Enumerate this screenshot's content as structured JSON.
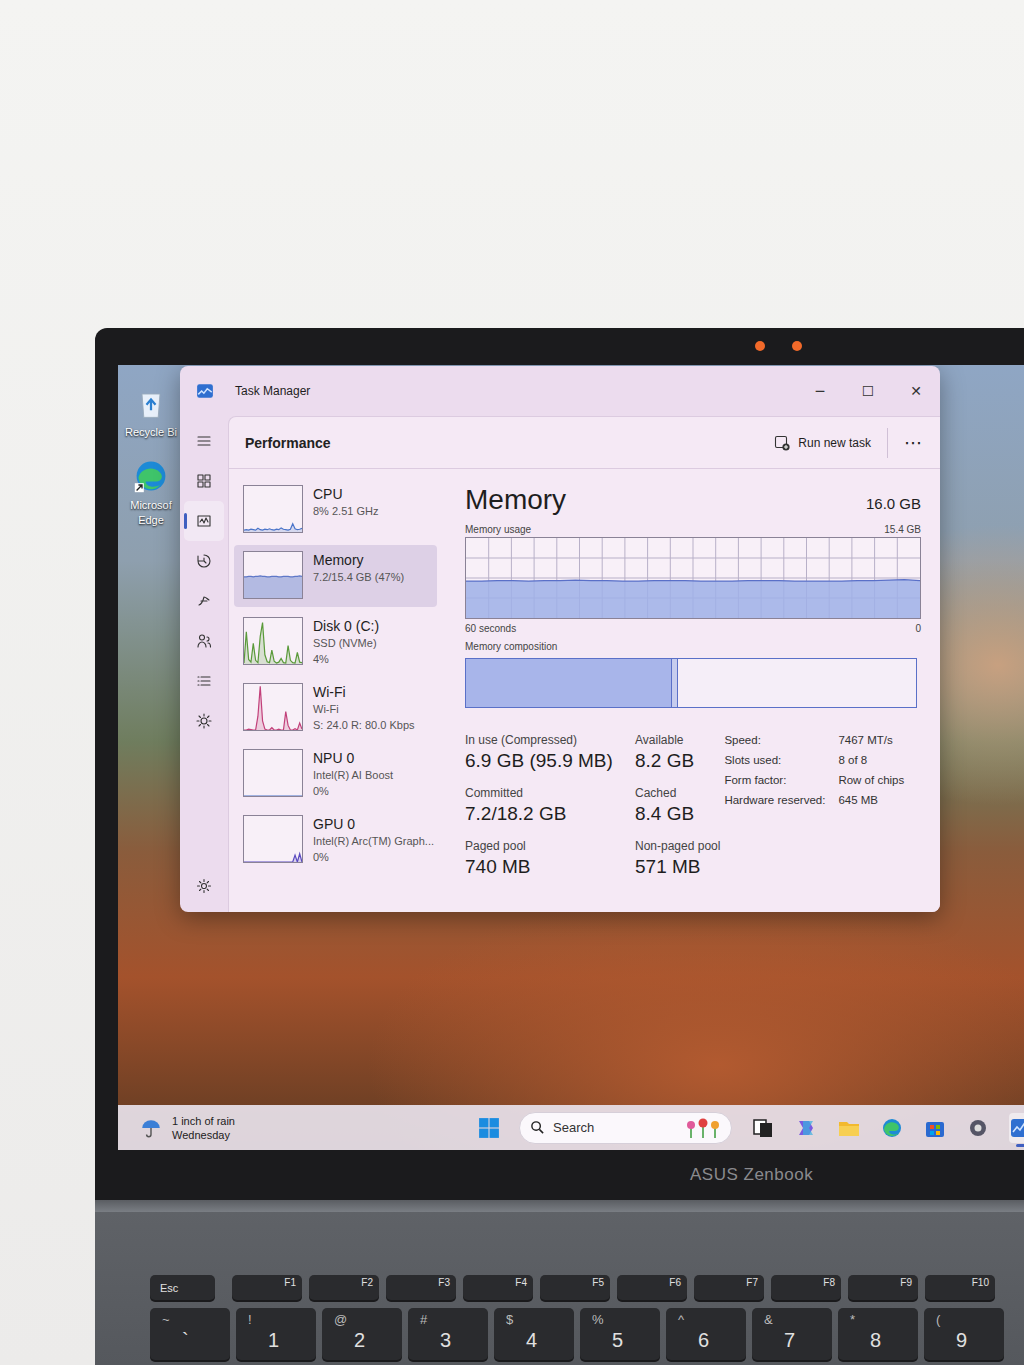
{
  "desktop": {
    "icons": [
      {
        "lines": [
          "Recycle Bi"
        ]
      },
      {
        "lines": [
          "Microsof",
          "Edge"
        ]
      }
    ]
  },
  "window": {
    "title": "Task Manager",
    "controls": [
      "─",
      "☐",
      "✕"
    ]
  },
  "nav": [
    {
      "selected": false
    },
    {
      "selected": false
    },
    {
      "selected": true
    },
    {
      "selected": false
    },
    {
      "selected": false
    },
    {
      "selected": false
    },
    {
      "selected": false
    },
    {
      "selected": false
    },
    {
      "selected": false
    }
  ],
  "header": {
    "title": "Performance",
    "runTask": "Run new task",
    "more": "⋯"
  },
  "resources": [
    {
      "name": "CPU",
      "lines": [
        "8% 2.51 GHz"
      ],
      "selected": false,
      "color": "#4a74c9",
      "values": [
        4,
        5,
        4,
        6,
        5,
        4,
        8,
        5,
        4,
        6,
        5,
        7,
        5,
        4,
        6,
        5,
        9,
        6,
        5,
        4,
        6,
        18,
        7,
        5,
        6,
        8
      ]
    },
    {
      "name": "Memory",
      "lines": [
        "7.2/15.4 GB (47%)"
      ],
      "selected": true,
      "color": "#5f78c8",
      "values": [
        46,
        46,
        47,
        47,
        46,
        47,
        47,
        48,
        47,
        47,
        46,
        46,
        47,
        47,
        47,
        46,
        46,
        47,
        47,
        47,
        46,
        46,
        47,
        47,
        48,
        47
      ]
    },
    {
      "name": "Disk 0 (C:)",
      "lines": [
        "SSD (NVMe)",
        "4%"
      ],
      "selected": false,
      "color": "#5a9a3a",
      "values": [
        2,
        70,
        10,
        4,
        45,
        8,
        3,
        60,
        90,
        20,
        5,
        3,
        30,
        6,
        2,
        4,
        12,
        3,
        2,
        40,
        8,
        3,
        2,
        25,
        4,
        3
      ]
    },
    {
      "name": "Wi-Fi",
      "lines": [
        "Wi-Fi",
        "S: 24.0 R: 80.0 Kbps"
      ],
      "selected": false,
      "color": "#c2407a",
      "values": [
        0,
        0,
        2,
        1,
        0,
        0,
        30,
        95,
        20,
        2,
        0,
        0,
        5,
        0,
        0,
        2,
        0,
        0,
        40,
        10,
        0,
        0,
        3,
        0,
        15,
        2
      ]
    },
    {
      "name": "NPU 0",
      "lines": [
        "Intel(R) AI Boost",
        "0%"
      ],
      "selected": false,
      "color": "#4a74c9",
      "values": [
        0,
        0,
        0,
        0,
        0,
        0,
        0,
        0,
        0,
        0,
        0,
        0,
        0,
        0,
        0,
        0,
        0,
        0,
        0,
        0,
        0,
        0,
        0,
        0,
        0,
        0
      ]
    },
    {
      "name": "GPU 0",
      "lines": [
        "Intel(R) Arc(TM) Graph...",
        "0%"
      ],
      "selected": false,
      "color": "#5a4ac0",
      "values": [
        0,
        0,
        0,
        0,
        0,
        0,
        0,
        0,
        0,
        0,
        0,
        0,
        0,
        0,
        0,
        0,
        0,
        0,
        0,
        0,
        0,
        0,
        15,
        0,
        18,
        0
      ]
    }
  ],
  "memory": {
    "title": "Memory",
    "total": "16.0 GB",
    "usageLabel": "Memory usage",
    "max": "15.4 GB",
    "maxValue": 15.4,
    "usage": [
      7.1,
      7.1,
      7.2,
      7.2,
      7.1,
      7.2,
      7.2,
      7.3,
      7.2,
      7.2,
      7.1,
      7.1,
      7.2,
      7.2,
      7.2,
      7.1,
      7.1,
      7.1,
      7.2,
      7.2,
      7.2,
      7.1,
      7.1,
      7.1,
      7.1,
      7.2,
      7.2,
      7.3,
      7.4,
      7.2
    ],
    "timeLeft": "60 seconds",
    "timeRight": "0",
    "compositionLabel": "Memory composition",
    "composition": [
      {
        "kind": "inuse",
        "level": 0.455
      },
      {
        "kind": "modified",
        "level": 0.012
      }
    ],
    "stats": [
      {
        "label": "In use (Compressed)",
        "value": "6.9 GB (95.9 MB)"
      },
      {
        "label": "Available",
        "value": "8.2 GB"
      },
      {
        "label": "Committed",
        "value": "7.2/18.2 GB"
      },
      {
        "label": "Cached",
        "value": "8.4 GB"
      },
      {
        "label": "Paged pool",
        "value": "740 MB"
      },
      {
        "label": "Non-paged pool",
        "value": "571 MB"
      }
    ],
    "specs": [
      {
        "label": "Speed:",
        "value": "7467 MT/s"
      },
      {
        "label": "Slots used:",
        "value": "8 of 8"
      },
      {
        "label": "Form factor:",
        "value": "Row of chips"
      },
      {
        "label": "Hardware reserved:",
        "value": "645 MB"
      }
    ]
  },
  "taskbar": {
    "weather": [
      "1 inch of rain",
      "Wednesday"
    ],
    "search": "Search",
    "apps": [
      {
        "active": false
      },
      {
        "active": false
      },
      {
        "active": false
      },
      {
        "active": false
      },
      {
        "active": false
      },
      {
        "active": false
      },
      {
        "active": true
      }
    ]
  },
  "laptop": {
    "brand": "ASUS Zenbook",
    "fkeys": [
      "Esc",
      "F1",
      "F2",
      "F3",
      "F4",
      "F5",
      "F6",
      "F7",
      "F8",
      "F9",
      "F10"
    ],
    "numberKeys": [
      {
        "top": "~",
        "main": "`"
      },
      {
        "top": "!",
        "main": "1"
      },
      {
        "top": "@",
        "main": "2"
      },
      {
        "top": "#",
        "main": "3"
      },
      {
        "top": "$",
        "main": "4"
      },
      {
        "top": "%",
        "main": "5"
      },
      {
        "top": "^",
        "main": "6"
      },
      {
        "top": "&",
        "main": "7"
      },
      {
        "top": "*",
        "main": "8"
      },
      {
        "top": "(",
        "main": "9"
      }
    ]
  }
}
